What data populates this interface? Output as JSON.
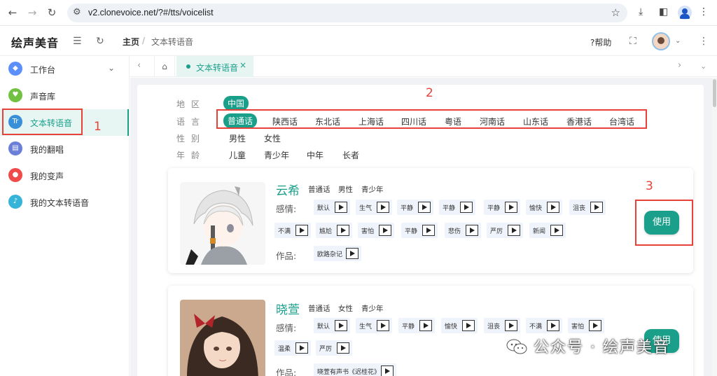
{
  "browser": {
    "url": "v2.clonevoice.net/?#/tts/voicelist"
  },
  "app": {
    "logo": "绘声美音",
    "breadcrumb": {
      "home": "主页",
      "sep": "/",
      "current": "文本转语音"
    },
    "help": "帮助"
  },
  "sidebar": {
    "items": [
      {
        "label": "工作台",
        "color": "#5b8ff9"
      },
      {
        "label": "声音库",
        "color": "#73c140"
      },
      {
        "label": "文本转语音",
        "color": "#3a8fd9"
      },
      {
        "label": "我的翻唱",
        "color": "#6c7fd8"
      },
      {
        "label": "我的变声",
        "color": "#f04b4b"
      },
      {
        "label": "我的文本转语音",
        "color": "#36b3d9"
      }
    ]
  },
  "tabs": {
    "current": "文本转语音"
  },
  "filters": {
    "region": {
      "label": "地区",
      "options": [
        "中国"
      ]
    },
    "language": {
      "label": "语言",
      "options": [
        "普通话",
        "陕西话",
        "东北话",
        "上海话",
        "四川话",
        "粤语",
        "河南话",
        "山东话",
        "香港话",
        "台湾话"
      ]
    },
    "gender": {
      "label": "性别",
      "options": [
        "男性",
        "女性"
      ]
    },
    "age": {
      "label": "年龄",
      "options": [
        "儿童",
        "青少年",
        "中年",
        "长者"
      ]
    }
  },
  "voices": [
    {
      "name": "云希",
      "tags": [
        "普通话",
        "男性",
        "青少年"
      ],
      "emotion_label": "感情:",
      "emotions": [
        "默认",
        "生气",
        "平静",
        "平静",
        "平静",
        "愉快",
        "沮丧",
        "不满",
        "尴尬",
        "害怕",
        "平静",
        "悲伤",
        "严厉",
        "新闻"
      ],
      "works_label": "作品:",
      "works": [
        "欧路杂记"
      ],
      "use": "使用"
    },
    {
      "name": "晓萱",
      "tags": [
        "普通话",
        "女性",
        "青少年"
      ],
      "emotion_label": "感情:",
      "emotions": [
        "默认",
        "生气",
        "平静",
        "愉快",
        "沮丧",
        "不满",
        "害怕",
        "温柔",
        "严厉"
      ],
      "works_label": "作品:",
      "works": [
        "晓萱有声书《迟桂花》"
      ],
      "use": "使用"
    }
  ],
  "annotations": [
    "1",
    "2",
    "3"
  ],
  "watermark": "公众号 · 绘声美音",
  "colors": {
    "accent": "#1aa08a",
    "annotation": "#e8413a"
  }
}
